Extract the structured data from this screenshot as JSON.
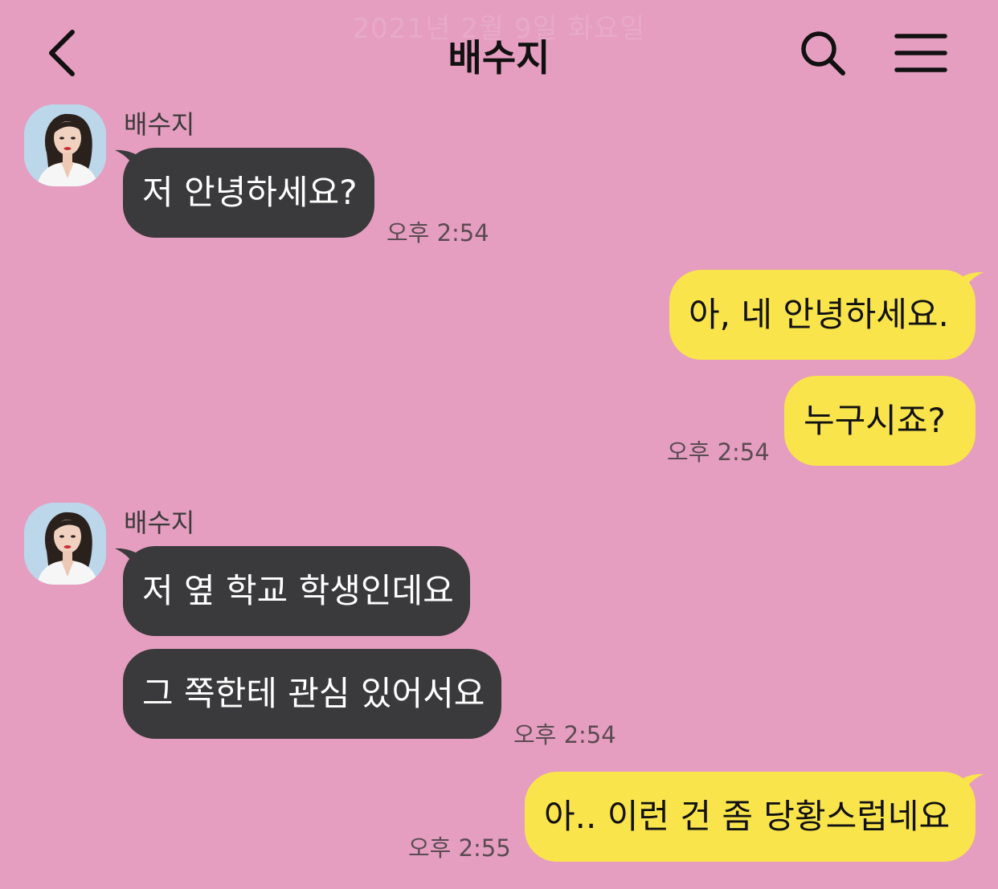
{
  "watermark_date": "2021년 2월 9일 화요일",
  "header": {
    "title": "배수지",
    "back_icon": "chevron-left-icon",
    "search_icon": "search-icon",
    "menu_icon": "hamburger-menu-icon"
  },
  "colors": {
    "background": "#e59ec0",
    "incoming_bubble": "#3a3a3c",
    "outgoing_bubble": "#fae44c"
  },
  "messages": [
    {
      "sender": "배수지",
      "text": "저 안녕하세요?",
      "time": "오후 2:54"
    },
    {
      "text": "아, 네 안녕하세요."
    },
    {
      "text": "누구시죠?",
      "time": "오후 2:54"
    },
    {
      "sender": "배수지",
      "text": "저 옆 학교 학생인데요"
    },
    {
      "text": "그 쪽한테 관심 있어서요",
      "time": "오후 2:54"
    },
    {
      "text": "아.. 이런 건 좀 당황스럽네요",
      "time": "오후 2:55"
    }
  ]
}
